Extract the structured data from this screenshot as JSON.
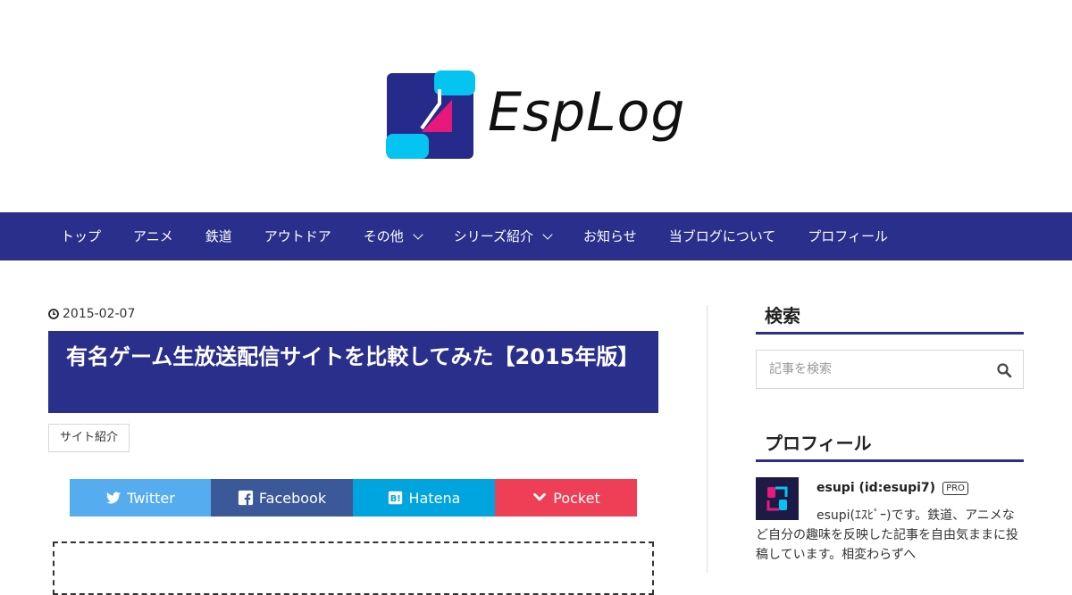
{
  "site": {
    "logo_text": "EspLog",
    "colors": {
      "primary": "#2a2f8c",
      "logo_pink": "#e8197d",
      "logo_cyan": "#05c4f2"
    }
  },
  "nav": {
    "items": [
      {
        "label": "トップ"
      },
      {
        "label": "アニメ"
      },
      {
        "label": "鉄道"
      },
      {
        "label": "アウトドア"
      },
      {
        "label": "その他",
        "dropdown": true
      },
      {
        "label": "シリーズ紹介",
        "dropdown": true
      },
      {
        "label": "お知らせ"
      },
      {
        "label": "当ブログについて"
      },
      {
        "label": "プロフィール"
      }
    ]
  },
  "article": {
    "date": "2015-02-07",
    "title": "有名ゲーム生放送配信サイトを比較してみた【2015年版】",
    "category": "サイト紹介",
    "share": {
      "twitter": "Twitter",
      "facebook": "Facebook",
      "hatena": "Hatena",
      "pocket": "Pocket",
      "colors": {
        "twitter": "#55acee",
        "facebook": "#3b5998",
        "hatena": "#00a4de",
        "pocket": "#ef3f56"
      }
    }
  },
  "sidebar": {
    "search": {
      "title": "検索",
      "placeholder": "記事を検索",
      "icon": "search-icon"
    },
    "profile": {
      "title": "プロフィール",
      "name": "esupi (id:esupi7)",
      "badge": "PRO",
      "description": "esupi(ｴｽﾋﾟｰ)です。鉄道、アニメなど自分の趣味を反映した記事を自由気ままに投稿しています。相変わらずへ"
    }
  }
}
